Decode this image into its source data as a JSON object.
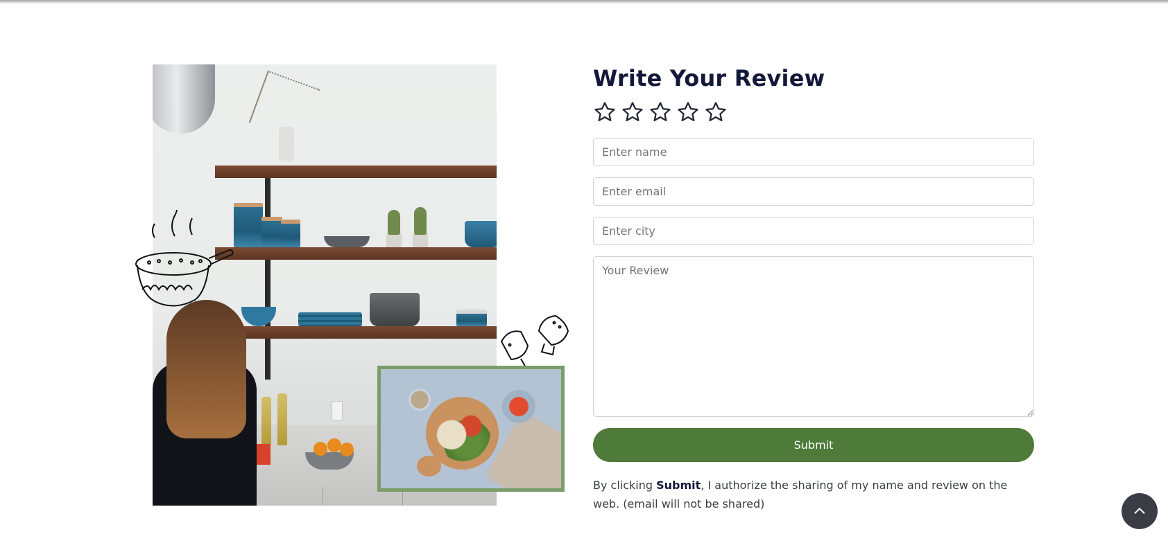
{
  "review": {
    "title": "Write Your Review",
    "rating": 0,
    "max_rating": 5,
    "stars": [
      "star-1",
      "star-2",
      "star-3",
      "star-4",
      "star-5"
    ],
    "name_placeholder": "Enter name",
    "email_placeholder": "Enter email",
    "city_placeholder": "Enter city",
    "review_placeholder": "Your Review",
    "submit_label": "Submit",
    "disclaimer_prefix": "By clicking ",
    "disclaimer_bold": "Submit",
    "disclaimer_suffix": ", I authorize the sharing of my name and review on the web. (email will not be shared)"
  },
  "icons": {
    "star": "star-outline-icon",
    "back_to_top": "chevron-up-icon"
  },
  "colors": {
    "title": "#14193a",
    "submit_bg": "#4e7b3a",
    "frame_border": "#7a9d6b",
    "back_to_top_bg": "#3a3d45"
  }
}
